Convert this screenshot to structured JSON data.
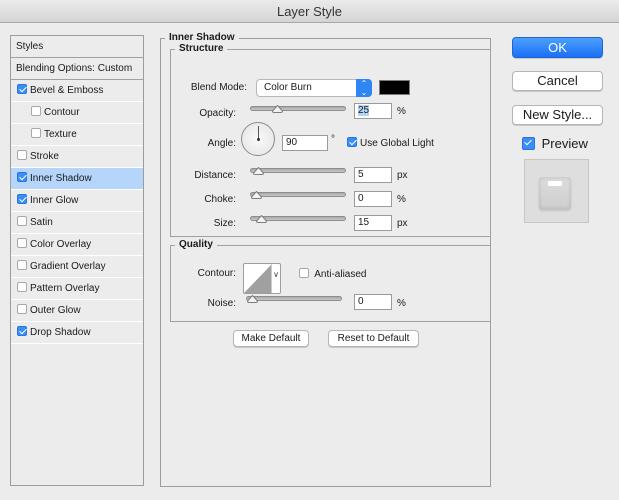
{
  "window": {
    "title": "Layer Style"
  },
  "styles_list": {
    "items": [
      {
        "label": "Styles",
        "type": "header"
      },
      {
        "label": "Blending Options: Custom",
        "type": "header"
      },
      {
        "label": "Bevel & Emboss",
        "checked": true
      },
      {
        "label": "Contour",
        "checked": false,
        "indent": true
      },
      {
        "label": "Texture",
        "checked": false,
        "indent": true
      },
      {
        "label": "Stroke",
        "checked": false
      },
      {
        "label": "Inner Shadow",
        "checked": true,
        "selected": true
      },
      {
        "label": "Inner Glow",
        "checked": true
      },
      {
        "label": "Satin",
        "checked": false
      },
      {
        "label": "Color Overlay",
        "checked": false
      },
      {
        "label": "Gradient Overlay",
        "checked": false
      },
      {
        "label": "Pattern Overlay",
        "checked": false
      },
      {
        "label": "Outer Glow",
        "checked": false
      },
      {
        "label": "Drop Shadow",
        "checked": true
      }
    ]
  },
  "panel": {
    "title": "Inner Shadow",
    "structure": {
      "title": "Structure",
      "blend_mode_label": "Blend Mode:",
      "blend_mode_value": "Color Burn",
      "color": "#000000",
      "opacity_label": "Opacity:",
      "opacity_value": "25",
      "opacity_unit": "%",
      "opacity_fraction": 0.25,
      "angle_label": "Angle:",
      "angle_value": "90",
      "angle_unit": "°",
      "use_global_light_label": "Use Global Light",
      "use_global_light": true,
      "distance_label": "Distance:",
      "distance_value": "5",
      "distance_unit": "px",
      "distance_fraction": 0.02,
      "choke_label": "Choke:",
      "choke_value": "0",
      "choke_unit": "%",
      "choke_fraction": 0.0,
      "size_label": "Size:",
      "size_value": "15",
      "size_unit": "px",
      "size_fraction": 0.06
    },
    "quality": {
      "title": "Quality",
      "contour_label": "Contour:",
      "anti_aliased_label": "Anti-aliased",
      "anti_aliased": false,
      "noise_label": "Noise:",
      "noise_value": "0",
      "noise_unit": "%",
      "noise_fraction": 0.0
    },
    "make_default_label": "Make Default",
    "reset_default_label": "Reset to Default"
  },
  "actions": {
    "ok_label": "OK",
    "cancel_label": "Cancel",
    "new_style_label": "New Style...",
    "preview_label": "Preview",
    "preview_checked": true
  }
}
